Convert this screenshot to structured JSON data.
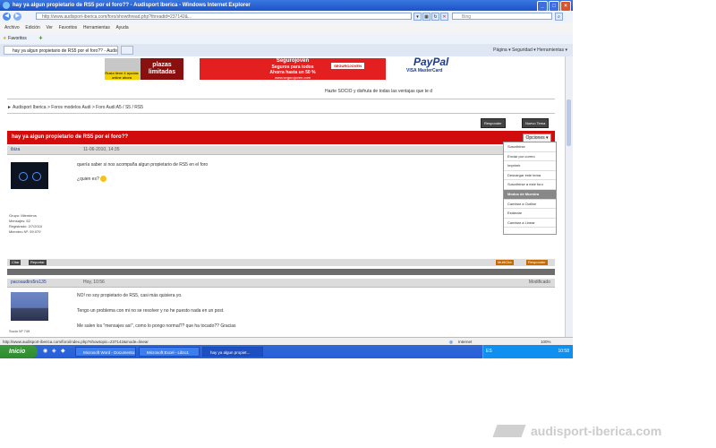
{
  "window": {
    "title": "hay ya algun propietario de RS5 por el foro?? - Audisport Iberica - Windows Internet Explorer",
    "controls": [
      "_",
      "□",
      "×"
    ]
  },
  "address": {
    "url": "http://www.audisport-iberica.com/foro/showthread.php?threadid=237142&...",
    "search_placeholder": "Bing"
  },
  "menu": [
    "Archivo",
    "Edición",
    "Ver",
    "Favoritos",
    "Herramientas",
    "Ayuda"
  ],
  "favorites": {
    "label": "Favoritos"
  },
  "tab": {
    "label": "hay ya algun propietario de RS5 por el foro?? - Audisp..."
  },
  "commandbar": "Página ▾  Seguridad ▾  Herramientas ▾",
  "banners": {
    "left_small": "Rusia tiene 4 ayudas online ahora",
    "left_main": "plazas limitadas",
    "mid_line1": "Segurojoven",
    "mid_line2": "Seguros para todos",
    "mid_line3": "Ahorra hasta un 50 %",
    "mid_url": "www.segurojoven.com",
    "mid_cta": "SEGUROJOVEN",
    "paypal": "PayPal",
    "paypal_cards": "VISA  MasterCard"
  },
  "invite": "Hazte SOCIO y disfruta de todas las ventajas que te d",
  "breadcrumb": "► Audisport Iberica > Foros modelos Audi > Foro Audi A5 / S5 / RS5",
  "buttons": {
    "new_reply": "Responder",
    "new_thread": "Nuevo Tema"
  },
  "thread": {
    "title": "hay ya algun propietario de RS5 por el foro??",
    "options_label": "Opciones ▾"
  },
  "posts": [
    {
      "user": "ibiza",
      "date": "11-06-2010, 14:35",
      "rank": "Grupo: Miembros",
      "messages": "Mensajes: 62",
      "registered": "Registrado: 2/7/2010",
      "member_id": "Miembro Nº: 59.079",
      "body1": "quería saber si nos acompaña algun propietario de RS5 en el foro",
      "body2": "¿quien es?"
    },
    {
      "user": "pacoaudirs5rs135",
      "date": "Hoy, 10:56",
      "edit_label": "Modificado",
      "socio": "Socio Nº 749",
      "body1": "NO! no soy propietario de RS5, casi más quisiera yo.",
      "body2": "Tengo un problema con mi no se resolver y no he puesto nada en un post.",
      "body3": "Me salen los \"mensajes así\", como lo pongo normal?? que ha tocado?? Gracias"
    }
  ],
  "post_actions": {
    "quote": "Citar",
    "report": "Reportar",
    "multiquote": "MultiCita",
    "reply": "Responder"
  },
  "dropdown": [
    {
      "label": "Suscribirse",
      "header": false
    },
    {
      "label": "Enviar por correo",
      "header": false
    },
    {
      "label": "Imprimir",
      "header": false
    },
    {
      "label": "Descargar este tema",
      "header": false
    },
    {
      "label": "Suscribirse a este foro",
      "header": false
    },
    {
      "label": "Modos de Muestra",
      "header": true
    },
    {
      "label": "Cambiar a Outline",
      "header": false
    },
    {
      "label": "Estándar",
      "header": false
    },
    {
      "label": "Cambiar a Linear",
      "header": false
    }
  ],
  "status": {
    "url": "http://www.audisport-iberica.com/foro/index.php?showtopic=237142&mode=linear",
    "zone": "Internet",
    "zoom": "100%"
  },
  "taskbar": {
    "start": "Inicio",
    "tasks": [
      {
        "label": "Microsoft Word - Documento1"
      },
      {
        "label": "Microsoft Excel - Libro1"
      },
      {
        "label": "hay ya algun propiet..."
      }
    ],
    "lang": "ES",
    "clock": "10:58"
  },
  "watermark": "audisport-iberica.com",
  "colors": {
    "thread_header": "#d00c0c",
    "taskbar": "#245edb",
    "start": "#2f8a2f"
  }
}
